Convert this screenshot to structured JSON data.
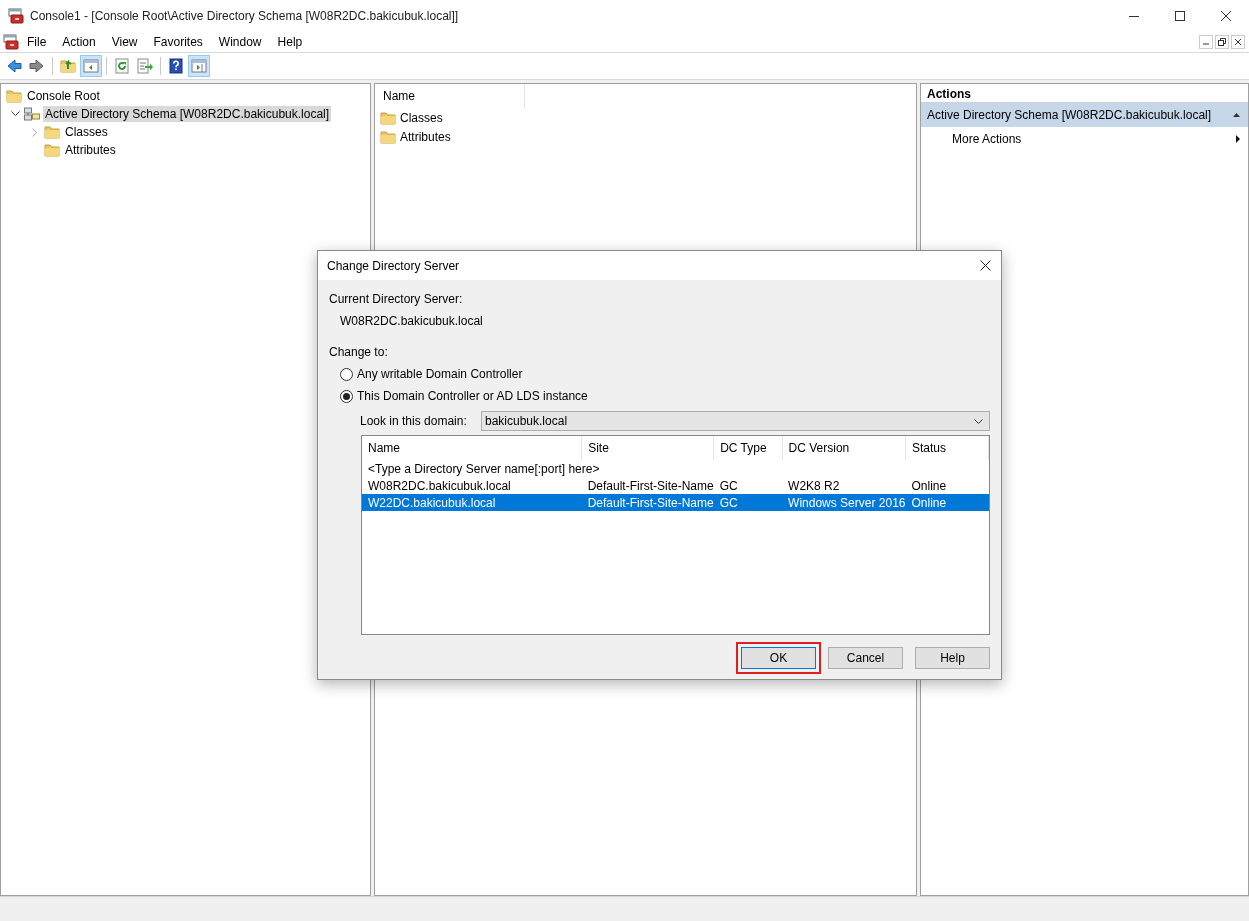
{
  "window": {
    "title": "Console1 - [Console Root\\Active Directory Schema [W08R2DC.bakicubuk.local]]"
  },
  "menu": [
    "File",
    "Action",
    "View",
    "Favorites",
    "Window",
    "Help"
  ],
  "toolbar": [
    {
      "kind": "back",
      "pressed": false
    },
    {
      "kind": "forward",
      "pressed": false
    },
    {
      "kind": "up",
      "pressed": false
    },
    {
      "kind": "tree",
      "pressed": true
    },
    {
      "kind": "refresh",
      "pressed": false
    },
    {
      "kind": "export",
      "pressed": false
    },
    {
      "kind": "help",
      "pressed": false
    },
    {
      "kind": "actionpane",
      "pressed": true
    }
  ],
  "tree": [
    {
      "label": "Console Root",
      "kind": "folder",
      "selected": false,
      "children": [
        {
          "label": "Active Directory Schema [W08R2DC.bakicubuk.local]",
          "kind": "schema",
          "expanded": true,
          "selected": true,
          "children": [
            {
              "label": "Classes",
              "kind": "folder",
              "expanded": false,
              "selected": false
            },
            {
              "label": "Attributes",
              "kind": "folder",
              "selected": false
            }
          ]
        }
      ]
    }
  ],
  "list_pane": {
    "column": "Name",
    "items": [
      "Classes",
      "Attributes"
    ]
  },
  "actions": {
    "title": "Actions",
    "section": "Active Directory Schema [W08R2DC.bakicubuk.local]",
    "expanded": true,
    "items": [
      "More Actions"
    ]
  },
  "dialog": {
    "title": "Change Directory Server",
    "current_label": "Current Directory Server:",
    "current_value": "W08R2DC.bakicubuk.local",
    "change_label": "Change to:",
    "options": [
      {
        "label": "Any writable Domain Controller",
        "selected": false
      },
      {
        "label": "This Domain Controller or AD LDS instance",
        "selected": true
      }
    ],
    "domain_label": "Look in this domain:",
    "domain_value": "bakicubuk.local",
    "columns": [
      "Name",
      "Site",
      "DC Type",
      "DC Version",
      "Status"
    ],
    "entry_prompt": "<Type a Directory Server name[:port] here>",
    "rows": [
      {
        "cells": [
          "W08R2DC.bakicubuk.local",
          "Default-First-Site-Name",
          "GC",
          "W2K8 R2",
          "Online"
        ],
        "selected": false
      },
      {
        "cells": [
          "W22DC.bakicubuk.local",
          "Default-First-Site-Name",
          "GC",
          "Windows Server 2016",
          "Online"
        ],
        "selected": true
      }
    ],
    "buttons": [
      {
        "label": "OK",
        "highlighted": true
      },
      {
        "label": "Cancel",
        "highlighted": false
      },
      {
        "label": "Help",
        "highlighted": false
      }
    ]
  }
}
